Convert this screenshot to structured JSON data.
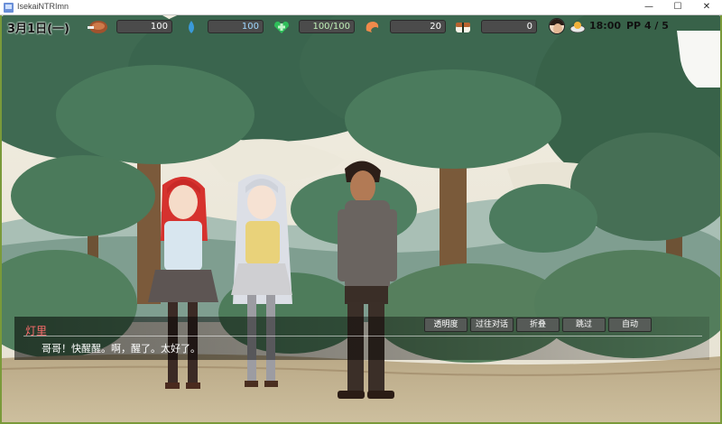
{
  "window": {
    "title": "IsekaiNTRImn",
    "icon": "app-icon",
    "minimize": "—",
    "maximize": "☐",
    "close": "✕"
  },
  "hud": {
    "date": "3月1日(一)",
    "stats": [
      {
        "icon": "meat-icon",
        "value": "100"
      },
      {
        "icon": "water-drop-icon",
        "value": "100"
      },
      {
        "icon": "heart-health-icon",
        "value": "100/100"
      },
      {
        "icon": "shrimp-icon",
        "value": "20"
      },
      {
        "icon": "sushi-icon",
        "value": "0"
      }
    ],
    "time": "18:00",
    "pp": "PP 4 / 5"
  },
  "dialog": {
    "speaker": "灯里",
    "text": "哥哥！快醒醒。啊，醒了。太好了。",
    "buttons": [
      "透明度",
      "过往对话",
      "折叠",
      "跳过",
      "自动"
    ]
  },
  "colors": {
    "speaker": "#ff6d6d",
    "bar_bg": "#4b4b4b",
    "foliage": "#3e6b50"
  }
}
